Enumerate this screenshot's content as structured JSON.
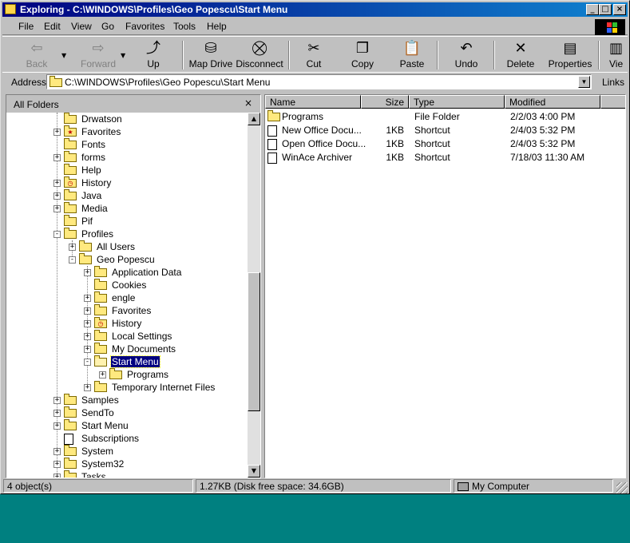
{
  "window": {
    "title": "Exploring - C:\\WINDOWS\\Profiles\\Geo Popescu\\Start Menu",
    "controls": {
      "minimize": "_",
      "maximize": "□",
      "close": "×"
    }
  },
  "menu": [
    "File",
    "Edit",
    "View",
    "Go",
    "Favorites",
    "Tools",
    "Help"
  ],
  "toolbar": {
    "back": "Back",
    "forward": "Forward",
    "up": "Up",
    "map_drive": "Map Drive",
    "disconnect": "Disconnect",
    "cut": "Cut",
    "copy": "Copy",
    "paste": "Paste",
    "undo": "Undo",
    "delete": "Delete",
    "properties": "Properties",
    "views": "Vie"
  },
  "address": {
    "label": "Address",
    "value": "C:\\WINDOWS\\Profiles\\Geo Popescu\\Start Menu",
    "links": "Links"
  },
  "left_pane": {
    "title": "All Folders",
    "close": "×",
    "tree": [
      {
        "label": "Drwatson",
        "exp": ""
      },
      {
        "label": "Favorites",
        "exp": "+",
        "icon": "favorites"
      },
      {
        "label": "Fonts",
        "exp": ""
      },
      {
        "label": "forms",
        "exp": "+"
      },
      {
        "label": "Help",
        "exp": ""
      },
      {
        "label": "History",
        "exp": "+",
        "icon": "history"
      },
      {
        "label": "Java",
        "exp": "+"
      },
      {
        "label": "Media",
        "exp": "+"
      },
      {
        "label": "Pif",
        "exp": ""
      },
      {
        "label": "Profiles",
        "exp": "-"
      },
      {
        "label": "All Users",
        "exp": "+"
      },
      {
        "label": "Geo Popescu",
        "exp": "-"
      },
      {
        "label": "Application Data",
        "exp": "+"
      },
      {
        "label": "Cookies",
        "exp": ""
      },
      {
        "label": "engle",
        "exp": "+"
      },
      {
        "label": "Favorites",
        "exp": "+"
      },
      {
        "label": "History",
        "exp": "+",
        "icon": "history"
      },
      {
        "label": "Local Settings",
        "exp": "+"
      },
      {
        "label": "My Documents",
        "exp": "+"
      },
      {
        "label": "Start Menu",
        "exp": "-",
        "selected": true
      },
      {
        "label": "Programs",
        "exp": "+"
      },
      {
        "label": "Temporary Internet Files",
        "exp": "+"
      },
      {
        "label": "Samples",
        "exp": "+"
      },
      {
        "label": "SendTo",
        "exp": "+"
      },
      {
        "label": "Start Menu",
        "exp": "+"
      },
      {
        "label": "Subscriptions",
        "exp": "",
        "icon": "subscriptions"
      },
      {
        "label": "System",
        "exp": "+"
      },
      {
        "label": "System32",
        "exp": "+"
      },
      {
        "label": "Tasks",
        "exp": "+"
      }
    ]
  },
  "list": {
    "columns": [
      "Name",
      "Size",
      "Type",
      "Modified"
    ],
    "rows": [
      {
        "name": "Programs",
        "size": "",
        "type": "File Folder",
        "modified": "2/2/03 4:00 PM",
        "icon": "folder"
      },
      {
        "name": "New Office Docu...",
        "size": "1KB",
        "type": "Shortcut",
        "modified": "2/4/03 5:32 PM",
        "icon": "shortcut"
      },
      {
        "name": "Open Office Docu...",
        "size": "1KB",
        "type": "Shortcut",
        "modified": "2/4/03 5:32 PM",
        "icon": "shortcut"
      },
      {
        "name": "WinAce Archiver",
        "size": "1KB",
        "type": "Shortcut",
        "modified": "7/18/03 11:30 AM",
        "icon": "shortcut"
      }
    ]
  },
  "status": {
    "objects": "4 object(s)",
    "size": "1.27KB (Disk free space: 34.6GB)",
    "location": "My Computer"
  }
}
